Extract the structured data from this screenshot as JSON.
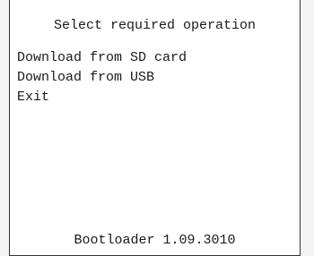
{
  "header": {
    "title": "Select required operation"
  },
  "menu": {
    "items": [
      {
        "label": "Download from SD card"
      },
      {
        "label": "Download from USB"
      },
      {
        "label": "Exit"
      }
    ]
  },
  "footer": {
    "version_text": "Bootloader 1.09.3010"
  },
  "colors": {
    "text": "#1a1a1a",
    "background": "#ffffff",
    "border": "#333333"
  }
}
